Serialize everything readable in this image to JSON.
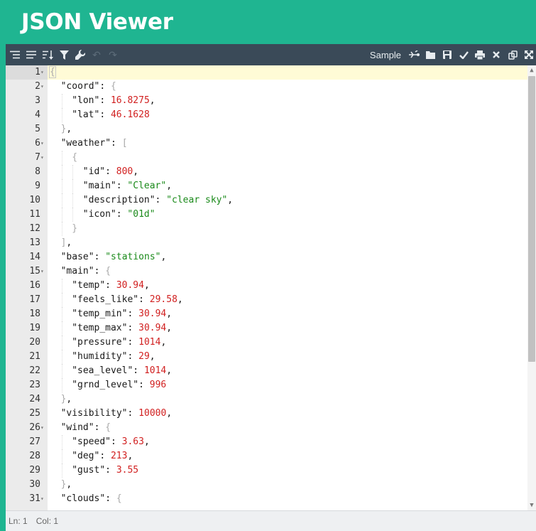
{
  "app": {
    "title": "JSON Viewer"
  },
  "toolbar": {
    "sample_label": "Sample",
    "left_icons": [
      "format-icon",
      "compact-icon",
      "sort-icon",
      "filter-icon",
      "repair-icon"
    ],
    "right_icons": [
      "transform-icon",
      "open-icon",
      "save-icon",
      "validate-icon",
      "print-icon",
      "clear-icon",
      "copy-icon",
      "fullscreen-icon"
    ]
  },
  "editor": {
    "active_line": 1,
    "lines": [
      {
        "num": "1",
        "fold": true,
        "indent": 0,
        "tokens": [
          [
            "pb",
            "{"
          ]
        ]
      },
      {
        "num": "2",
        "fold": true,
        "indent": 1,
        "tokens": [
          [
            "k",
            "\"coord\""
          ],
          [
            "p",
            ": "
          ],
          [
            "pb",
            "{"
          ]
        ]
      },
      {
        "num": "3",
        "fold": false,
        "indent": 2,
        "tokens": [
          [
            "k",
            "\"lon\""
          ],
          [
            "p",
            ": "
          ],
          [
            "n",
            "16.8275"
          ],
          [
            "p",
            ","
          ]
        ]
      },
      {
        "num": "4",
        "fold": false,
        "indent": 2,
        "tokens": [
          [
            "k",
            "\"lat\""
          ],
          [
            "p",
            ": "
          ],
          [
            "n",
            "46.1628"
          ]
        ]
      },
      {
        "num": "5",
        "fold": false,
        "indent": 1,
        "tokens": [
          [
            "pb",
            "}"
          ],
          [
            "p",
            ","
          ]
        ]
      },
      {
        "num": "6",
        "fold": true,
        "indent": 1,
        "tokens": [
          [
            "k",
            "\"weather\""
          ],
          [
            "p",
            ": "
          ],
          [
            "pb",
            "["
          ]
        ]
      },
      {
        "num": "7",
        "fold": true,
        "indent": 2,
        "tokens": [
          [
            "pb",
            "{"
          ]
        ]
      },
      {
        "num": "8",
        "fold": false,
        "indent": 3,
        "tokens": [
          [
            "k",
            "\"id\""
          ],
          [
            "p",
            ": "
          ],
          [
            "n",
            "800"
          ],
          [
            "p",
            ","
          ]
        ]
      },
      {
        "num": "9",
        "fold": false,
        "indent": 3,
        "tokens": [
          [
            "k",
            "\"main\""
          ],
          [
            "p",
            ": "
          ],
          [
            "s",
            "\"Clear\""
          ],
          [
            "p",
            ","
          ]
        ]
      },
      {
        "num": "10",
        "fold": false,
        "indent": 3,
        "tokens": [
          [
            "k",
            "\"description\""
          ],
          [
            "p",
            ": "
          ],
          [
            "s",
            "\"clear sky\""
          ],
          [
            "p",
            ","
          ]
        ]
      },
      {
        "num": "11",
        "fold": false,
        "indent": 3,
        "tokens": [
          [
            "k",
            "\"icon\""
          ],
          [
            "p",
            ": "
          ],
          [
            "s",
            "\"01d\""
          ]
        ]
      },
      {
        "num": "12",
        "fold": false,
        "indent": 2,
        "tokens": [
          [
            "pb",
            "}"
          ]
        ]
      },
      {
        "num": "13",
        "fold": false,
        "indent": 1,
        "tokens": [
          [
            "pb",
            "]"
          ],
          [
            "p",
            ","
          ]
        ]
      },
      {
        "num": "14",
        "fold": false,
        "indent": 1,
        "tokens": [
          [
            "k",
            "\"base\""
          ],
          [
            "p",
            ": "
          ],
          [
            "s",
            "\"stations\""
          ],
          [
            "p",
            ","
          ]
        ]
      },
      {
        "num": "15",
        "fold": true,
        "indent": 1,
        "tokens": [
          [
            "k",
            "\"main\""
          ],
          [
            "p",
            ": "
          ],
          [
            "pb",
            "{"
          ]
        ]
      },
      {
        "num": "16",
        "fold": false,
        "indent": 2,
        "tokens": [
          [
            "k",
            "\"temp\""
          ],
          [
            "p",
            ": "
          ],
          [
            "n",
            "30.94"
          ],
          [
            "p",
            ","
          ]
        ]
      },
      {
        "num": "17",
        "fold": false,
        "indent": 2,
        "tokens": [
          [
            "k",
            "\"feels_like\""
          ],
          [
            "p",
            ": "
          ],
          [
            "n",
            "29.58"
          ],
          [
            "p",
            ","
          ]
        ]
      },
      {
        "num": "18",
        "fold": false,
        "indent": 2,
        "tokens": [
          [
            "k",
            "\"temp_min\""
          ],
          [
            "p",
            ": "
          ],
          [
            "n",
            "30.94"
          ],
          [
            "p",
            ","
          ]
        ]
      },
      {
        "num": "19",
        "fold": false,
        "indent": 2,
        "tokens": [
          [
            "k",
            "\"temp_max\""
          ],
          [
            "p",
            ": "
          ],
          [
            "n",
            "30.94"
          ],
          [
            "p",
            ","
          ]
        ]
      },
      {
        "num": "20",
        "fold": false,
        "indent": 2,
        "tokens": [
          [
            "k",
            "\"pressure\""
          ],
          [
            "p",
            ": "
          ],
          [
            "n",
            "1014"
          ],
          [
            "p",
            ","
          ]
        ]
      },
      {
        "num": "21",
        "fold": false,
        "indent": 2,
        "tokens": [
          [
            "k",
            "\"humidity\""
          ],
          [
            "p",
            ": "
          ],
          [
            "n",
            "29"
          ],
          [
            "p",
            ","
          ]
        ]
      },
      {
        "num": "22",
        "fold": false,
        "indent": 2,
        "tokens": [
          [
            "k",
            "\"sea_level\""
          ],
          [
            "p",
            ": "
          ],
          [
            "n",
            "1014"
          ],
          [
            "p",
            ","
          ]
        ]
      },
      {
        "num": "23",
        "fold": false,
        "indent": 2,
        "tokens": [
          [
            "k",
            "\"grnd_level\""
          ],
          [
            "p",
            ": "
          ],
          [
            "n",
            "996"
          ]
        ]
      },
      {
        "num": "24",
        "fold": false,
        "indent": 1,
        "tokens": [
          [
            "pb",
            "}"
          ],
          [
            "p",
            ","
          ]
        ]
      },
      {
        "num": "25",
        "fold": false,
        "indent": 1,
        "tokens": [
          [
            "k",
            "\"visibility\""
          ],
          [
            "p",
            ": "
          ],
          [
            "n",
            "10000"
          ],
          [
            "p",
            ","
          ]
        ]
      },
      {
        "num": "26",
        "fold": true,
        "indent": 1,
        "tokens": [
          [
            "k",
            "\"wind\""
          ],
          [
            "p",
            ": "
          ],
          [
            "pb",
            "{"
          ]
        ]
      },
      {
        "num": "27",
        "fold": false,
        "indent": 2,
        "tokens": [
          [
            "k",
            "\"speed\""
          ],
          [
            "p",
            ": "
          ],
          [
            "n",
            "3.63"
          ],
          [
            "p",
            ","
          ]
        ]
      },
      {
        "num": "28",
        "fold": false,
        "indent": 2,
        "tokens": [
          [
            "k",
            "\"deg\""
          ],
          [
            "p",
            ": "
          ],
          [
            "n",
            "213"
          ],
          [
            "p",
            ","
          ]
        ]
      },
      {
        "num": "29",
        "fold": false,
        "indent": 2,
        "tokens": [
          [
            "k",
            "\"gust\""
          ],
          [
            "p",
            ": "
          ],
          [
            "n",
            "3.55"
          ]
        ]
      },
      {
        "num": "30",
        "fold": false,
        "indent": 1,
        "tokens": [
          [
            "pb",
            "}"
          ],
          [
            "p",
            ","
          ]
        ]
      },
      {
        "num": "31",
        "fold": true,
        "indent": 1,
        "tokens": [
          [
            "k",
            "\"clouds\""
          ],
          [
            "p",
            ": "
          ],
          [
            "pb",
            "{"
          ]
        ]
      }
    ]
  },
  "status": {
    "line": "Ln: 1",
    "col": "Col: 1"
  }
}
